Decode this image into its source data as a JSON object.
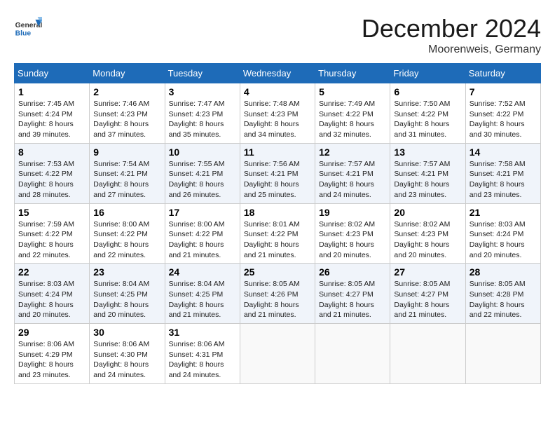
{
  "header": {
    "logo": {
      "line1": "General",
      "line2": "Blue"
    },
    "month": "December 2024",
    "location": "Moorenweis, Germany"
  },
  "days_of_week": [
    "Sunday",
    "Monday",
    "Tuesday",
    "Wednesday",
    "Thursday",
    "Friday",
    "Saturday"
  ],
  "weeks": [
    [
      {
        "day": "1",
        "sunrise": "7:45 AM",
        "sunset": "4:24 PM",
        "daylight": "8 hours and 39 minutes."
      },
      {
        "day": "2",
        "sunrise": "7:46 AM",
        "sunset": "4:23 PM",
        "daylight": "8 hours and 37 minutes."
      },
      {
        "day": "3",
        "sunrise": "7:47 AM",
        "sunset": "4:23 PM",
        "daylight": "8 hours and 35 minutes."
      },
      {
        "day": "4",
        "sunrise": "7:48 AM",
        "sunset": "4:23 PM",
        "daylight": "8 hours and 34 minutes."
      },
      {
        "day": "5",
        "sunrise": "7:49 AM",
        "sunset": "4:22 PM",
        "daylight": "8 hours and 32 minutes."
      },
      {
        "day": "6",
        "sunrise": "7:50 AM",
        "sunset": "4:22 PM",
        "daylight": "8 hours and 31 minutes."
      },
      {
        "day": "7",
        "sunrise": "7:52 AM",
        "sunset": "4:22 PM",
        "daylight": "8 hours and 30 minutes."
      }
    ],
    [
      {
        "day": "8",
        "sunrise": "7:53 AM",
        "sunset": "4:22 PM",
        "daylight": "8 hours and 28 minutes."
      },
      {
        "day": "9",
        "sunrise": "7:54 AM",
        "sunset": "4:21 PM",
        "daylight": "8 hours and 27 minutes."
      },
      {
        "day": "10",
        "sunrise": "7:55 AM",
        "sunset": "4:21 PM",
        "daylight": "8 hours and 26 minutes."
      },
      {
        "day": "11",
        "sunrise": "7:56 AM",
        "sunset": "4:21 PM",
        "daylight": "8 hours and 25 minutes."
      },
      {
        "day": "12",
        "sunrise": "7:57 AM",
        "sunset": "4:21 PM",
        "daylight": "8 hours and 24 minutes."
      },
      {
        "day": "13",
        "sunrise": "7:57 AM",
        "sunset": "4:21 PM",
        "daylight": "8 hours and 23 minutes."
      },
      {
        "day": "14",
        "sunrise": "7:58 AM",
        "sunset": "4:21 PM",
        "daylight": "8 hours and 23 minutes."
      }
    ],
    [
      {
        "day": "15",
        "sunrise": "7:59 AM",
        "sunset": "4:22 PM",
        "daylight": "8 hours and 22 minutes."
      },
      {
        "day": "16",
        "sunrise": "8:00 AM",
        "sunset": "4:22 PM",
        "daylight": "8 hours and 22 minutes."
      },
      {
        "day": "17",
        "sunrise": "8:00 AM",
        "sunset": "4:22 PM",
        "daylight": "8 hours and 21 minutes."
      },
      {
        "day": "18",
        "sunrise": "8:01 AM",
        "sunset": "4:22 PM",
        "daylight": "8 hours and 21 minutes."
      },
      {
        "day": "19",
        "sunrise": "8:02 AM",
        "sunset": "4:23 PM",
        "daylight": "8 hours and 20 minutes."
      },
      {
        "day": "20",
        "sunrise": "8:02 AM",
        "sunset": "4:23 PM",
        "daylight": "8 hours and 20 minutes."
      },
      {
        "day": "21",
        "sunrise": "8:03 AM",
        "sunset": "4:24 PM",
        "daylight": "8 hours and 20 minutes."
      }
    ],
    [
      {
        "day": "22",
        "sunrise": "8:03 AM",
        "sunset": "4:24 PM",
        "daylight": "8 hours and 20 minutes."
      },
      {
        "day": "23",
        "sunrise": "8:04 AM",
        "sunset": "4:25 PM",
        "daylight": "8 hours and 20 minutes."
      },
      {
        "day": "24",
        "sunrise": "8:04 AM",
        "sunset": "4:25 PM",
        "daylight": "8 hours and 21 minutes."
      },
      {
        "day": "25",
        "sunrise": "8:05 AM",
        "sunset": "4:26 PM",
        "daylight": "8 hours and 21 minutes."
      },
      {
        "day": "26",
        "sunrise": "8:05 AM",
        "sunset": "4:27 PM",
        "daylight": "8 hours and 21 minutes."
      },
      {
        "day": "27",
        "sunrise": "8:05 AM",
        "sunset": "4:27 PM",
        "daylight": "8 hours and 21 minutes."
      },
      {
        "day": "28",
        "sunrise": "8:05 AM",
        "sunset": "4:28 PM",
        "daylight": "8 hours and 22 minutes."
      }
    ],
    [
      {
        "day": "29",
        "sunrise": "8:06 AM",
        "sunset": "4:29 PM",
        "daylight": "8 hours and 23 minutes."
      },
      {
        "day": "30",
        "sunrise": "8:06 AM",
        "sunset": "4:30 PM",
        "daylight": "8 hours and 24 minutes."
      },
      {
        "day": "31",
        "sunrise": "8:06 AM",
        "sunset": "4:31 PM",
        "daylight": "8 hours and 24 minutes."
      },
      null,
      null,
      null,
      null
    ]
  ],
  "labels": {
    "sunrise": "Sunrise:",
    "sunset": "Sunset:",
    "daylight": "Daylight:"
  }
}
